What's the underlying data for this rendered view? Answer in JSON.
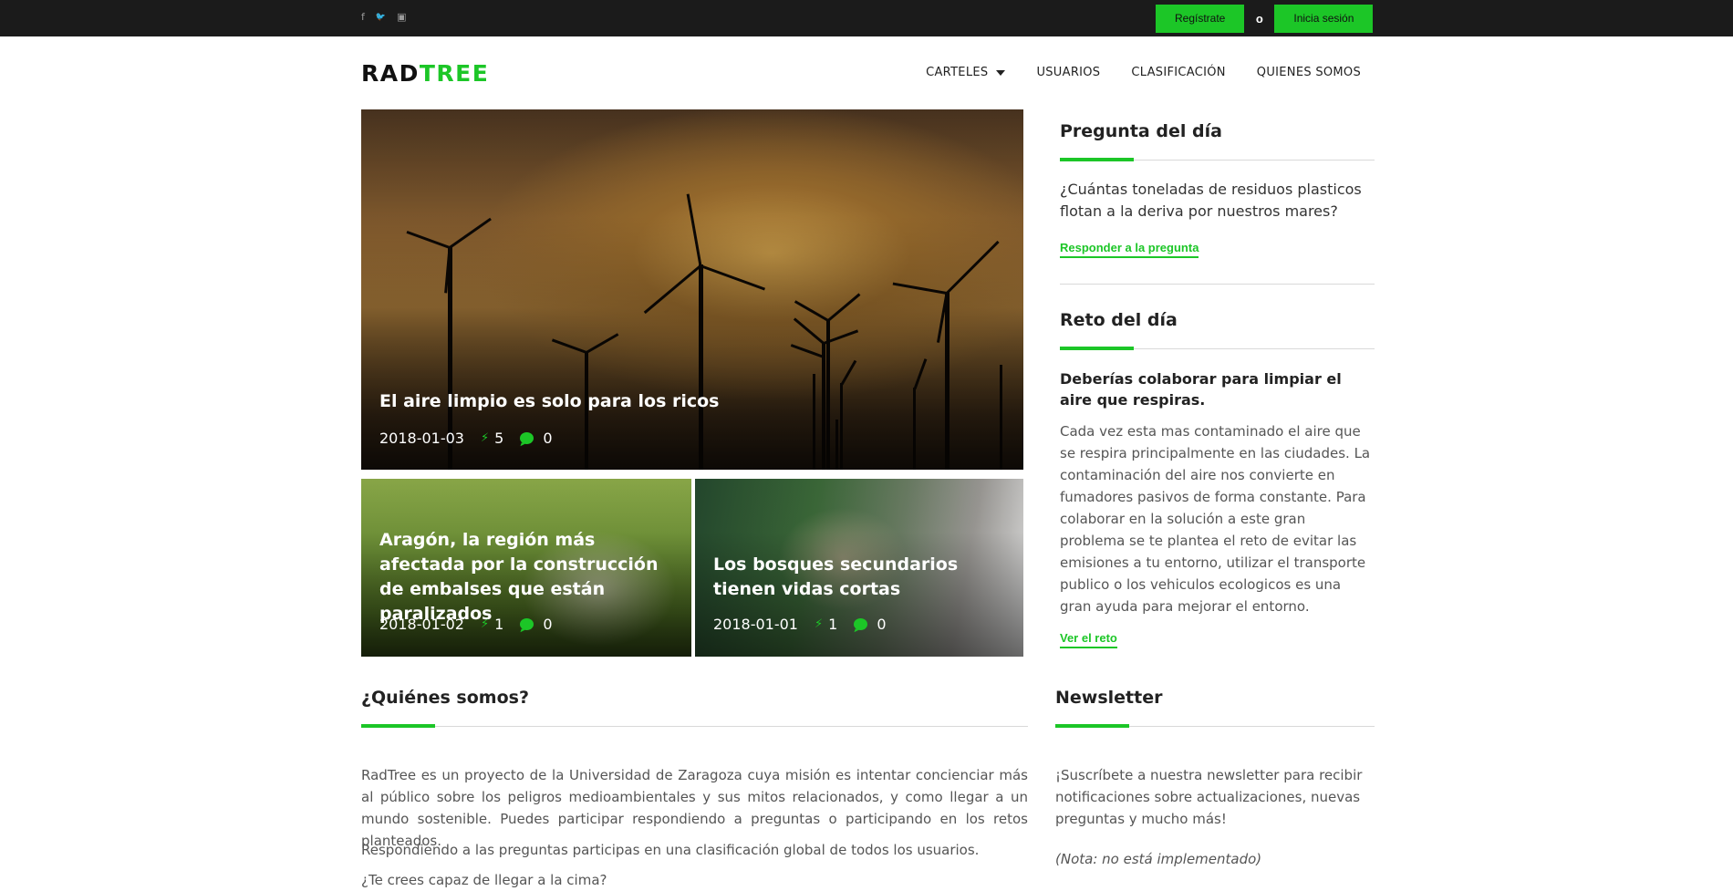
{
  "topbar": {
    "social": [
      {
        "icon": "facebook-icon",
        "glyph": "f"
      },
      {
        "icon": "twitter-icon",
        "glyph": "🐦"
      },
      {
        "icon": "instagram-icon",
        "glyph": "▣"
      }
    ],
    "register_label": "Regístrate",
    "or_label": "o",
    "login_label": "Inicia sesión"
  },
  "header": {
    "logo_part1": "RAD",
    "logo_part2": "TREE",
    "nav": [
      "CARTELES",
      "USUARIOS",
      "CLASIFICACIÓN",
      "QUIENES SOMOS"
    ]
  },
  "posts": [
    {
      "title": "El aire limpio es solo para los ricos",
      "date": "2018-01-03",
      "likes": "5",
      "comments": "0"
    },
    {
      "title": "Aragón, la región más afectada por la construcción de embalses que están paralizados",
      "date": "2018-01-02",
      "likes": "1",
      "comments": "0"
    },
    {
      "title": "Los bosques secundarios tienen vidas cortas",
      "date": "2018-01-01",
      "likes": "1",
      "comments": "0"
    }
  ],
  "question": {
    "heading": "Pregunta del día",
    "text": "¿Cuántas toneladas de residuos plasticos flotan a la deriva por nuestros mares?",
    "link": "Responder a la pregunta"
  },
  "challenge": {
    "heading": "Reto del día",
    "title": "Deberías colaborar para limpiar el aire que respiras.",
    "body": "Cada vez esta mas contaminado el aire que se respira principalmente en las ciudades. La contaminación del aire nos convierte en fumadores pasivos de forma constante. Para colaborar en la solución a este gran problema se te plantea el reto de evitar las emisiones a tu entorno, utilizar el transporte publico o los vehiculos ecologicos es una gran ayuda para mejorar el entorno.",
    "link": "Ver el reto"
  },
  "about": {
    "heading": "¿Quiénes somos?",
    "p1": "RadTree es un proyecto de la Universidad de Zaragoza cuya misión es intentar concienciar más al público sobre los peligros medioambientales y sus mitos relacionados, y como llegar a un mundo sostenible. Puedes participar respondiendo a preguntas o participando en los retos planteados.",
    "p2": "Respondiendo a las preguntas participas en una clasificación global de todos los usuarios.",
    "p3": "¿Te crees capaz de llegar a la cima?"
  },
  "newsletter": {
    "heading": "Newsletter",
    "text": "¡Suscríbete a nuestra newsletter para recibir notificaciones sobre actualizaciones, nuevas preguntas y mucho más!",
    "note": "(Nota: no está implementado)"
  },
  "colors": {
    "accent": "#1cc627",
    "topbar": "#1b1b1b"
  }
}
